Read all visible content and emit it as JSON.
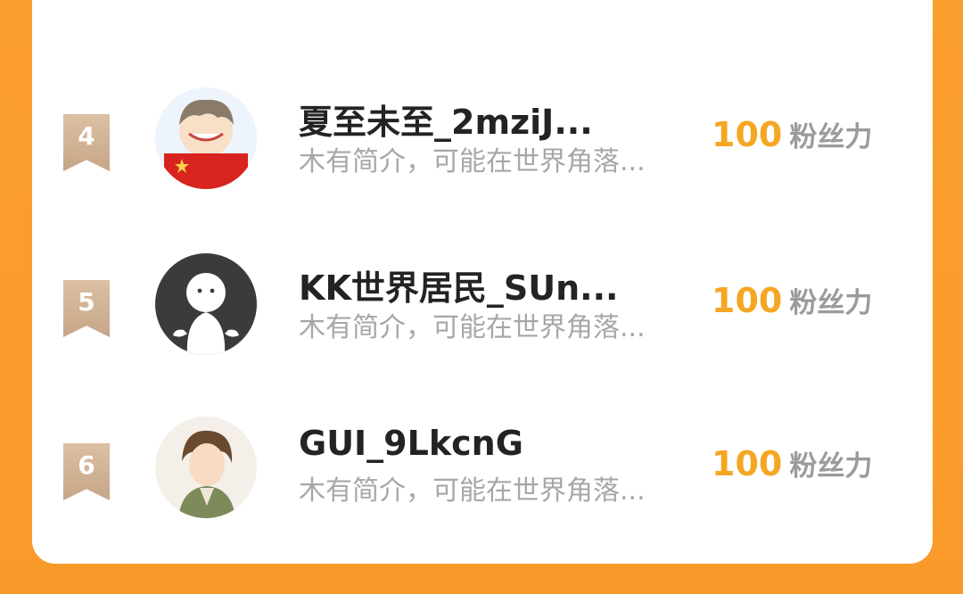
{
  "rows": [
    {
      "rank": "4",
      "name": "夏至未至_2mziJ...",
      "bio": "木有简介，可能在世界角落...",
      "score": "100",
      "score_label": "粉丝力"
    },
    {
      "rank": "5",
      "name": "KK世界居民_SUn...",
      "bio": "木有简介，可能在世界角落...",
      "score": "100",
      "score_label": "粉丝力"
    },
    {
      "rank": "6",
      "name": "GUI_9LkcnG",
      "bio": "木有简介，可能在世界角落...",
      "score": "100",
      "score_label": "粉丝力"
    }
  ]
}
